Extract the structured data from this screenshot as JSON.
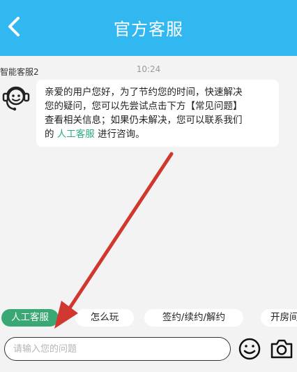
{
  "header": {
    "title": "官方客服"
  },
  "chat": {
    "timestamp": "10:24",
    "bot_name": "智能客服2",
    "message": {
      "line1": "亲爱的用户您好，为了节约您的时间，快速解决",
      "line2": "您的疑问，您可以先尝试点击下方【常见问题】",
      "line3": "查看相关信息；如果仍未解决，您可以联系我们",
      "line4_prefix": "的 ",
      "line4_link": "人工客服",
      "line4_suffix": " 进行咨询。"
    }
  },
  "quick_replies": [
    "人工客服",
    "怎么玩",
    "签约/续约/解约",
    "开房间"
  ],
  "input": {
    "placeholder": "请输入您的问题"
  },
  "colors": {
    "header_bg": "#32b8f1",
    "active_chip": "#3aa874",
    "link": "#27ae7e",
    "annotation_arrow": "#d0382f"
  },
  "icons": {
    "back": "chevron-left-icon",
    "avatar": "headset-bot-icon",
    "emoji": "smiley-icon",
    "camera": "camera-icon"
  }
}
